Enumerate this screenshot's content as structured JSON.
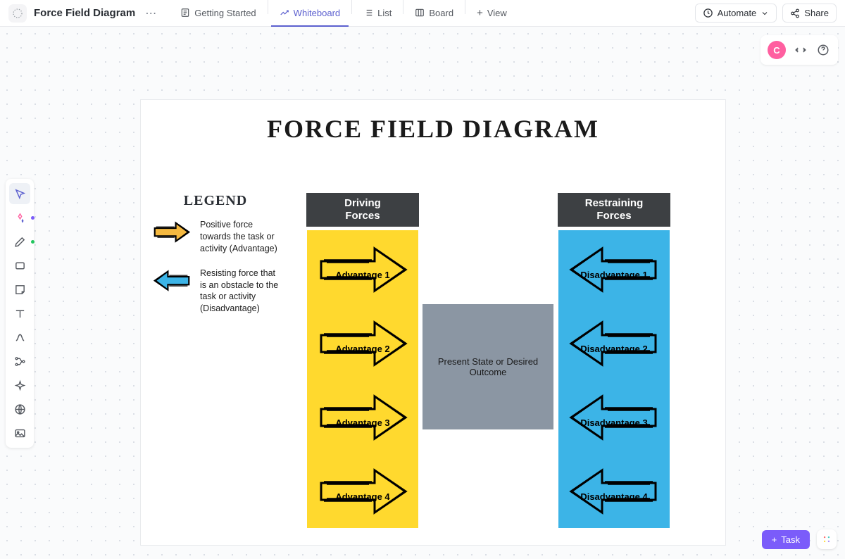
{
  "doc": {
    "title": "Force Field Diagram"
  },
  "tabs": {
    "getting_started": "Getting Started",
    "whiteboard": "Whiteboard",
    "list": "List",
    "board": "Board",
    "view": "View"
  },
  "header": {
    "automate": "Automate",
    "share": "Share",
    "avatar_letter": "C"
  },
  "board": {
    "title": "FORCE FIELD DIAGRAM",
    "legend_title": "LEGEND",
    "legend_positive": "Positive force towards the task or activity (Advantage)",
    "legend_negative": "Resisting force that is an obstacle to the task or activity (Disadvantage)",
    "col_driving": "Driving\nForces",
    "col_restraining": "Restraining\nForces",
    "center": "Present State or Desired Outcome",
    "advantages": [
      "Advantage 1",
      "Advantage 2",
      "Advantage 3",
      "Advantage 4"
    ],
    "disadvantages": [
      "Disadvantage 1",
      "Disadvantage 2",
      "Disadvantage 3",
      "Disadvantage 4"
    ]
  },
  "footer": {
    "task": "Task"
  }
}
